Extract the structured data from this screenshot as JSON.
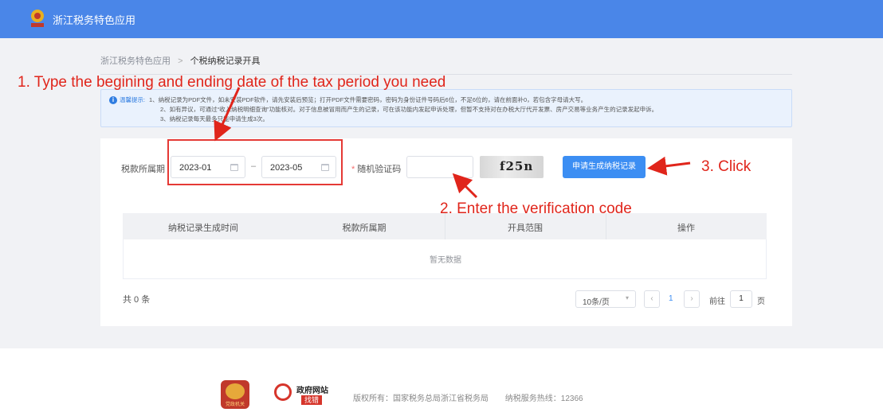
{
  "header": {
    "app_title": "浙江税务特色应用"
  },
  "breadcrumb": {
    "root": "浙江税务特色应用",
    "separator": ">",
    "current": "个税纳税记录开具"
  },
  "notice": {
    "label": "温馨提示:",
    "line1": "1、纳税记录为PDF文件，如未安装PDF软件，请先安装后预览；打开PDF文件需要密码，密码为身份证件号码后6位，不足6位的，请在前面补0，若包含字母请大写。",
    "line2": "2、如有异议，可通过“收入纳税明细查询”功能核对。对于信息被冒用而产生的记录，可在该功能内发起申诉处理，但暂不支持对在办税大厅代开发票、房产交易等业务产生的记录发起申诉。",
    "line3": "3、纳税记录每天最多只能申请生成3次。"
  },
  "form": {
    "period_label": "税款所属期",
    "date_from": "2023-01",
    "date_to": "2023-05",
    "range_separator": "–",
    "captcha_required_mark": "*",
    "captcha_label": "随机验证码",
    "captcha_value": "",
    "captcha_image_text": "f25n",
    "apply_button": "申请生成纳税记录"
  },
  "table": {
    "columns": [
      "纳税记录生成时间",
      "税款所属期",
      "开具范围",
      "操作"
    ],
    "empty_text": "暂无数据"
  },
  "pagination": {
    "total": "共 0 条",
    "page_size": "10条/页",
    "current_page": "1",
    "goto_label": "前往",
    "goto_value": "1",
    "page_suffix": "页"
  },
  "footer": {
    "badge_caption": "党政机关",
    "gov_site_title": "政府网站",
    "gov_site_sub": "找错",
    "copyright": "版权所有：国家税务总局浙江省税务局",
    "hotline": "纳税服务热线：12366"
  },
  "annotations": {
    "step1": "1. Type the begining and ending date of the tax period you need",
    "step2": "2. Enter the verification code",
    "step3": "3. Click"
  },
  "colors": {
    "header_bg": "#4a86e8",
    "primary": "#3c8ef3",
    "annotation": "#e0251b"
  }
}
